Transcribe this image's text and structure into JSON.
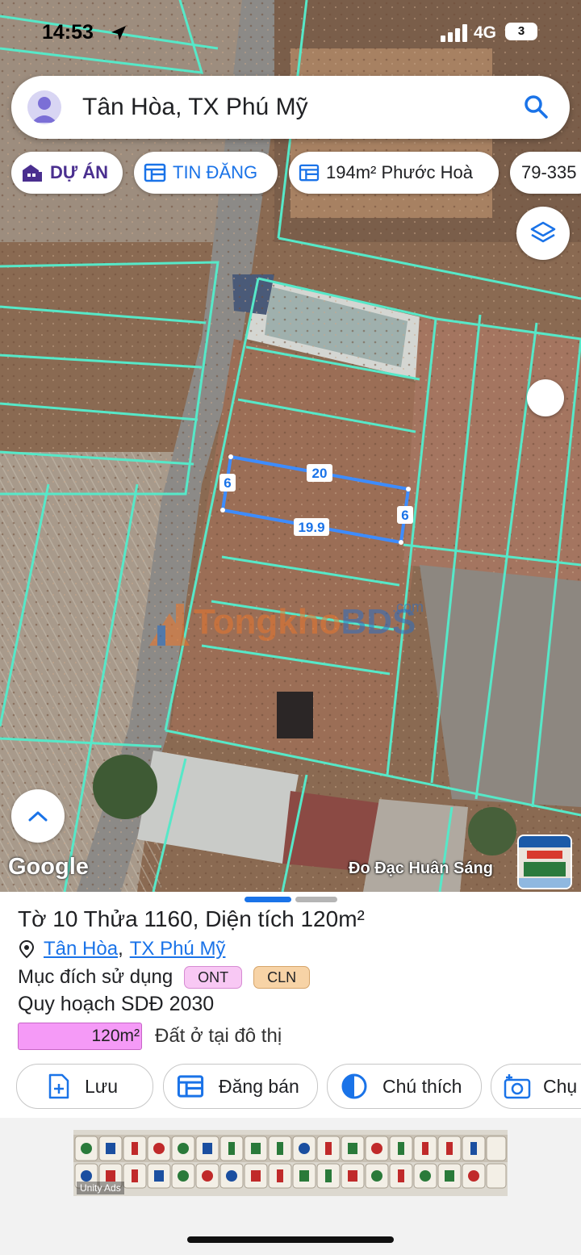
{
  "status_bar": {
    "time": "14:53",
    "network": "4G",
    "battery": "3"
  },
  "search": {
    "query": "Tân Hòa, TX Phú Mỹ"
  },
  "chips": [
    {
      "label": "DỰ ÁN",
      "icon": "building-icon",
      "color": "#4a2f8f"
    },
    {
      "label": "TIN ĐĂNG",
      "icon": "listing-icon",
      "color": "#1a73e8"
    },
    {
      "label": "194m² Phước Hoà",
      "icon": "listing-icon",
      "color": "#202124"
    },
    {
      "label": "79-335",
      "icon": null,
      "color": "#202124"
    }
  ],
  "map": {
    "parcel_dimensions": {
      "top": "20",
      "bottom": "19.9",
      "left": "6",
      "right": "6"
    },
    "watermark": {
      "part1": "Tongkho",
      "part2": "BDS",
      "suffix": ".com"
    },
    "google_label": "Google",
    "credit": "Đo Đạc Huân Sáng",
    "boundary_color": "#56e8c8",
    "selected_parcel_color": "#3d8cff"
  },
  "sheet": {
    "title": "Tờ 10 Thửa 1160, Diện tích 120m²",
    "address": {
      "ward": "Tân Hòa",
      "separator": ",",
      "district": "TX Phú Mỹ"
    },
    "purpose_label": "Mục đích sử dụng",
    "purpose_tags": [
      {
        "code": "ONT",
        "color": "#f8c8f4"
      },
      {
        "code": "CLN",
        "color": "#f7d3a6"
      }
    ],
    "plan_label": "Quy hoạch SDĐ 2030",
    "plan_area": "120m²",
    "plan_use": "Đất ở tại đô thị",
    "plan_color": "#f59af7"
  },
  "actions": [
    {
      "label": "Lưu",
      "icon": "add-file-icon"
    },
    {
      "label": "Đăng bán",
      "icon": "listing-icon"
    },
    {
      "label": "Chú thích",
      "icon": "legend-icon"
    },
    {
      "label": "Chụ",
      "icon": "camera-icon"
    }
  ],
  "ad": {
    "label": "Unity Ads"
  },
  "accent_color": "#1a73e8"
}
